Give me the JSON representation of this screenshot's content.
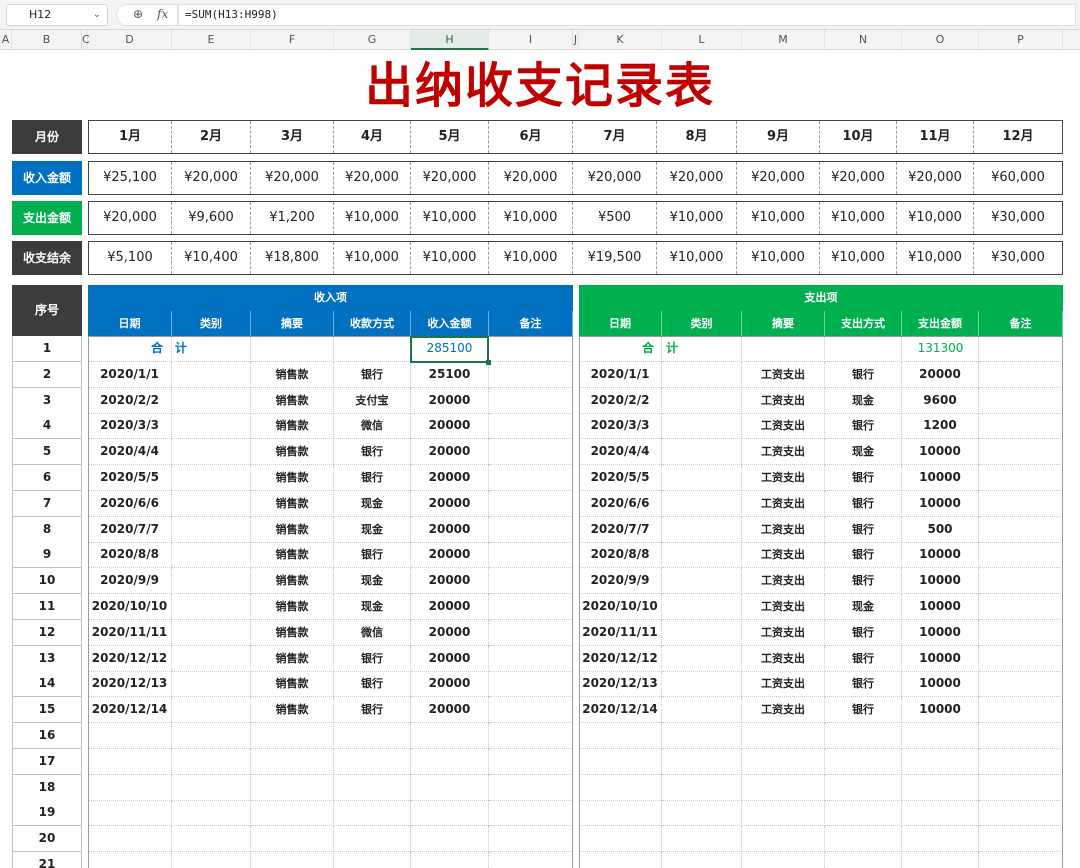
{
  "formula_bar": {
    "name_box": "H12",
    "formula": "=SUM(H13:H998)",
    "zoom_icon": "zoom-icon",
    "fx_label": "fx"
  },
  "column_headers": [
    "A",
    "B",
    "C",
    "D",
    "E",
    "F",
    "G",
    "H",
    "I",
    "J",
    "K",
    "L",
    "M",
    "N",
    "O",
    "P"
  ],
  "selected_column": "H",
  "title": "出纳收支记录表",
  "summary": {
    "month_label": "月份",
    "months": [
      "1月",
      "2月",
      "3月",
      "4月",
      "5月",
      "6月",
      "7月",
      "8月",
      "9月",
      "10月",
      "11月",
      "12月"
    ],
    "income_label": "收入金额",
    "income": [
      "¥25,100",
      "¥20,000",
      "¥20,000",
      "¥20,000",
      "¥20,000",
      "¥20,000",
      "¥20,000",
      "¥20,000",
      "¥20,000",
      "¥20,000",
      "¥20,000",
      "¥60,000"
    ],
    "expense_label": "支出金额",
    "expense": [
      "¥20,000",
      "¥9,600",
      "¥1,200",
      "¥10,000",
      "¥10,000",
      "¥10,000",
      "¥500",
      "¥10,000",
      "¥10,000",
      "¥10,000",
      "¥10,000",
      "¥30,000"
    ],
    "balance_label": "收支结余",
    "balance": [
      "¥5,100",
      "¥10,400",
      "¥18,800",
      "¥10,000",
      "¥10,000",
      "¥10,000",
      "¥19,500",
      "¥10,000",
      "¥10,000",
      "¥10,000",
      "¥10,000",
      "¥30,000"
    ]
  },
  "colors": {
    "title": "#c00000",
    "dark": "#3c3c3c",
    "blue": "#0070c0",
    "green": "#00b050"
  },
  "table": {
    "seq_header": "序号",
    "income_group": "收入项",
    "income_headers": [
      "日期",
      "类别",
      "摘要",
      "收款方式",
      "收入金额",
      "备注"
    ],
    "expense_group": "支出项",
    "expense_headers": [
      "日期",
      "类别",
      "摘要",
      "支出方式",
      "支出金额",
      "备注"
    ],
    "total_label": "合　计",
    "income_total": "285100",
    "expense_total": "131300",
    "seq": [
      "1",
      "2",
      "3",
      "4",
      "5",
      "6",
      "7",
      "8",
      "9",
      "10",
      "11",
      "12",
      "13",
      "14",
      "15",
      "16",
      "17",
      "18",
      "19",
      "20",
      "21"
    ],
    "income_rows": [
      [
        "2020/1/1",
        "",
        "销售款",
        "银行",
        "25100",
        ""
      ],
      [
        "2020/2/2",
        "",
        "销售款",
        "支付宝",
        "20000",
        ""
      ],
      [
        "2020/3/3",
        "",
        "销售款",
        "微信",
        "20000",
        ""
      ],
      [
        "2020/4/4",
        "",
        "销售款",
        "银行",
        "20000",
        ""
      ],
      [
        "2020/5/5",
        "",
        "销售款",
        "银行",
        "20000",
        ""
      ],
      [
        "2020/6/6",
        "",
        "销售款",
        "现金",
        "20000",
        ""
      ],
      [
        "2020/7/7",
        "",
        "销售款",
        "现金",
        "20000",
        ""
      ],
      [
        "2020/8/8",
        "",
        "销售款",
        "银行",
        "20000",
        ""
      ],
      [
        "2020/9/9",
        "",
        "销售款",
        "现金",
        "20000",
        ""
      ],
      [
        "2020/10/10",
        "",
        "销售款",
        "现金",
        "20000",
        ""
      ],
      [
        "2020/11/11",
        "",
        "销售款",
        "微信",
        "20000",
        ""
      ],
      [
        "2020/12/12",
        "",
        "销售款",
        "银行",
        "20000",
        ""
      ],
      [
        "2020/12/13",
        "",
        "销售款",
        "银行",
        "20000",
        ""
      ],
      [
        "2020/12/14",
        "",
        "销售款",
        "银行",
        "20000",
        ""
      ]
    ],
    "expense_rows": [
      [
        "2020/1/1",
        "",
        "工资支出",
        "银行",
        "20000",
        ""
      ],
      [
        "2020/2/2",
        "",
        "工资支出",
        "现金",
        "9600",
        ""
      ],
      [
        "2020/3/3",
        "",
        "工资支出",
        "银行",
        "1200",
        ""
      ],
      [
        "2020/4/4",
        "",
        "工资支出",
        "现金",
        "10000",
        ""
      ],
      [
        "2020/5/5",
        "",
        "工资支出",
        "银行",
        "10000",
        ""
      ],
      [
        "2020/6/6",
        "",
        "工资支出",
        "银行",
        "10000",
        ""
      ],
      [
        "2020/7/7",
        "",
        "工资支出",
        "银行",
        "500",
        ""
      ],
      [
        "2020/8/8",
        "",
        "工资支出",
        "银行",
        "10000",
        ""
      ],
      [
        "2020/9/9",
        "",
        "工资支出",
        "银行",
        "10000",
        ""
      ],
      [
        "2020/10/10",
        "",
        "工资支出",
        "现金",
        "10000",
        ""
      ],
      [
        "2020/11/11",
        "",
        "工资支出",
        "银行",
        "10000",
        ""
      ],
      [
        "2020/12/12",
        "",
        "工资支出",
        "银行",
        "10000",
        ""
      ],
      [
        "2020/12/13",
        "",
        "工资支出",
        "银行",
        "10000",
        ""
      ],
      [
        "2020/12/14",
        "",
        "工资支出",
        "银行",
        "10000",
        ""
      ]
    ]
  }
}
